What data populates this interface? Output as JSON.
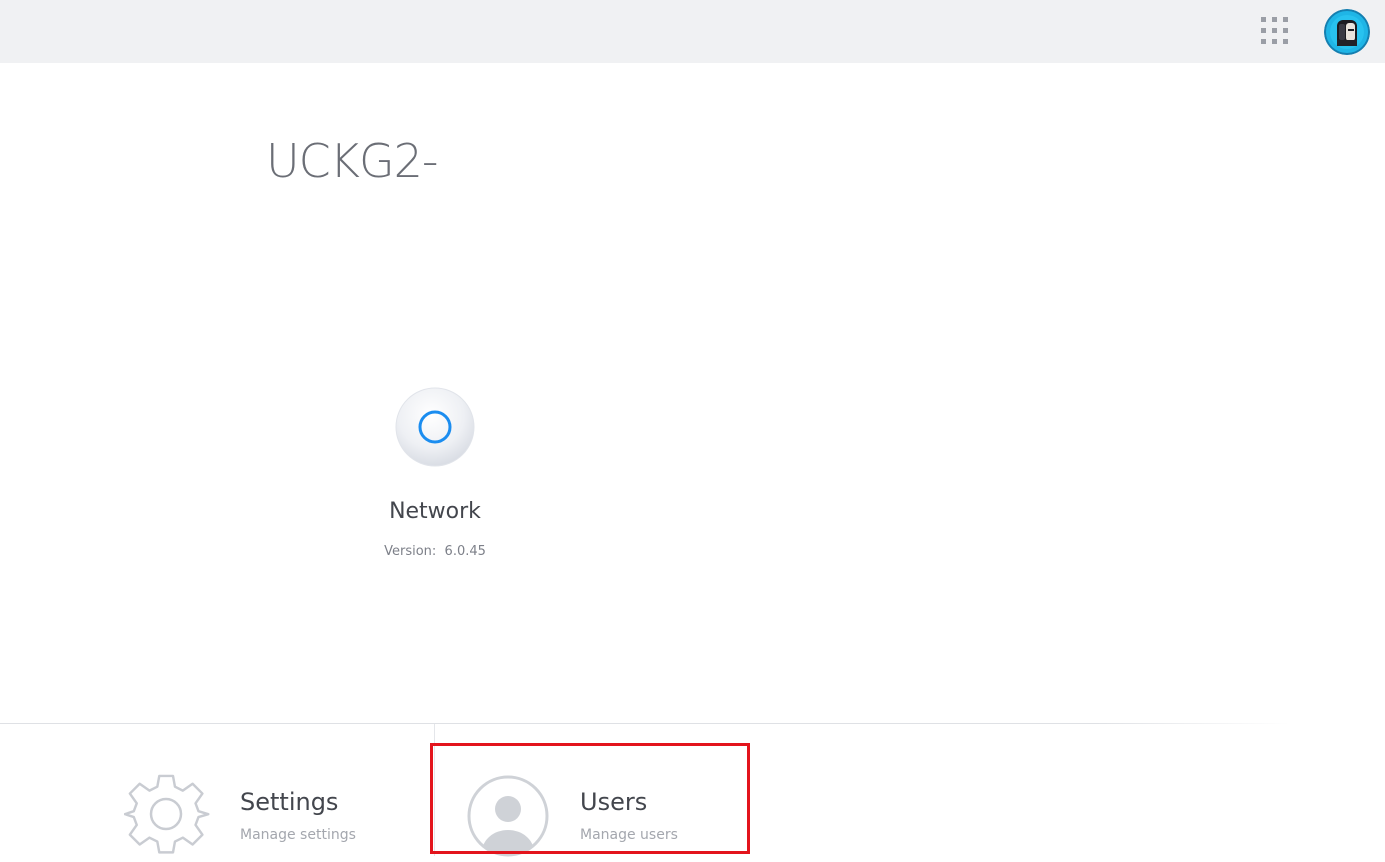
{
  "header": {
    "apps_icon": "grid-apps-icon",
    "avatar_icon": "user-avatar"
  },
  "console": {
    "name": "UCKG2-"
  },
  "apps": [
    {
      "name": "Network",
      "version_label": "Version:",
      "version": "6.0.45",
      "icon": "unifi-network-icon",
      "accent": "#1b8df0"
    }
  ],
  "bottom_nav": {
    "settings": {
      "title": "Settings",
      "subtitle": "Manage settings",
      "icon": "gear-icon"
    },
    "users": {
      "title": "Users",
      "subtitle": "Manage users",
      "icon": "user-icon"
    }
  },
  "colors": {
    "topbar": "#f0f1f3",
    "highlight": "#e3141c",
    "text_primary": "#43464d",
    "text_secondary": "#a4a7ae"
  }
}
